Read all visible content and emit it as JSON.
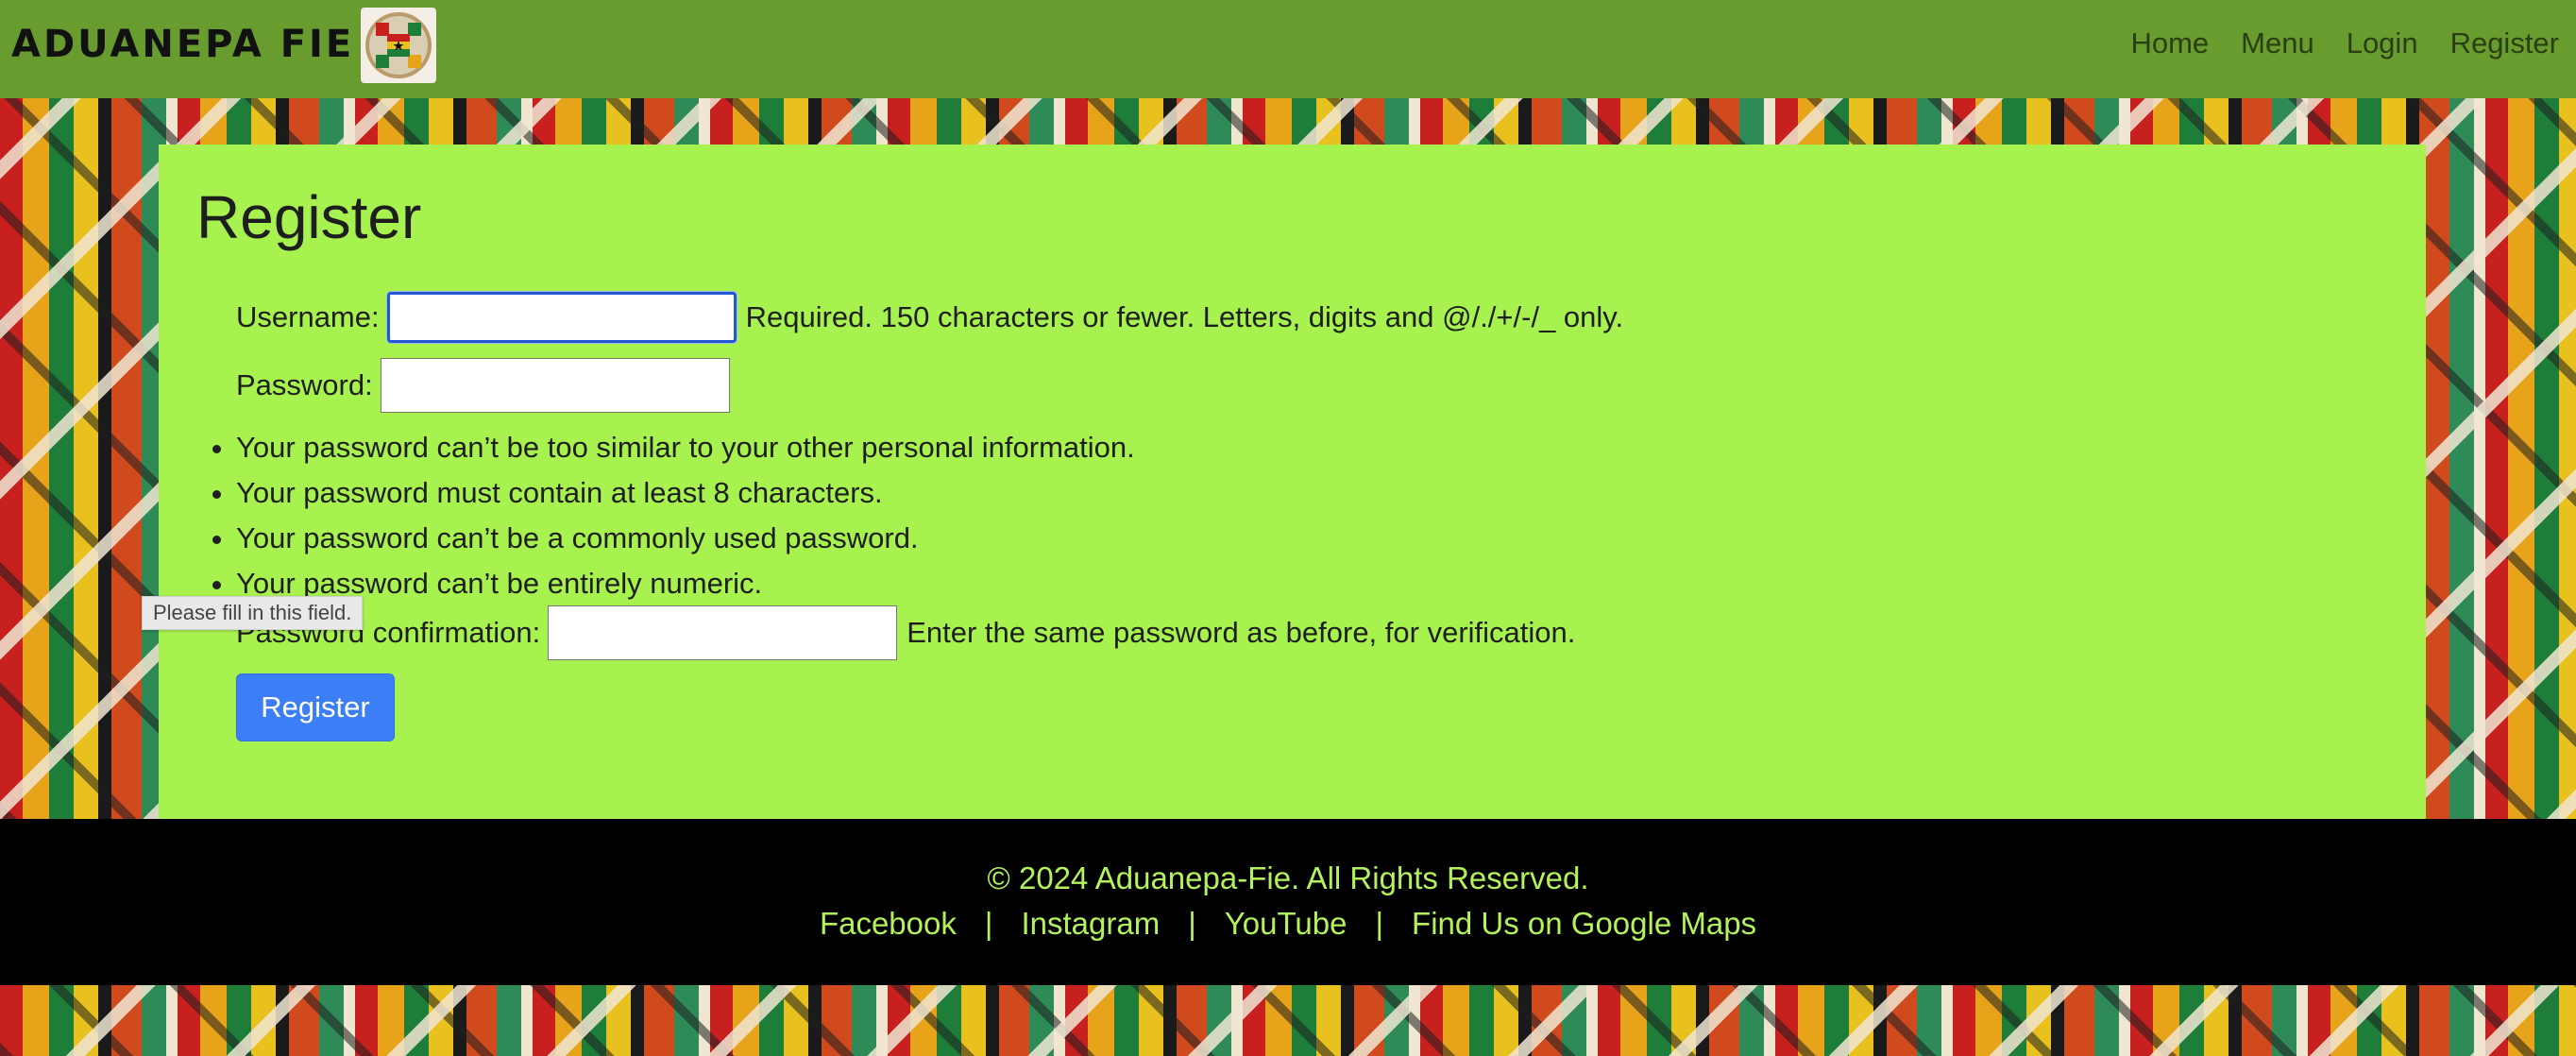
{
  "navbar": {
    "brand": "ADUANEPA FIE",
    "links": [
      "Home",
      "Menu",
      "Login",
      "Register"
    ]
  },
  "form": {
    "title": "Register",
    "username_label": "Username:",
    "username_help": "Required. 150 characters or fewer. Letters, digits and @/./+/-/_ only.",
    "password_label": "Password:",
    "password_rules": [
      "Your password can’t be too similar to your other personal information.",
      "Your password must contain at least 8 characters.",
      "Your password can’t be a commonly used password.",
      "Your password can’t be entirely numeric."
    ],
    "confirm_label": "Password confirmation:",
    "confirm_help": "Enter the same password as before, for verification.",
    "submit_label": "Register",
    "tooltip": "Please fill in this field."
  },
  "footer": {
    "copyright": "© 2024 Aduanepa-Fie. All Rights Reserved.",
    "links": [
      "Facebook",
      "Instagram",
      "YouTube",
      "Find Us on Google Maps"
    ],
    "separator": "|"
  },
  "colors": {
    "navbar": "#689c2e",
    "card": "#a8f24f",
    "footer_bg": "#000000",
    "footer_text": "#b4f25c",
    "button": "#3b7ef6"
  }
}
